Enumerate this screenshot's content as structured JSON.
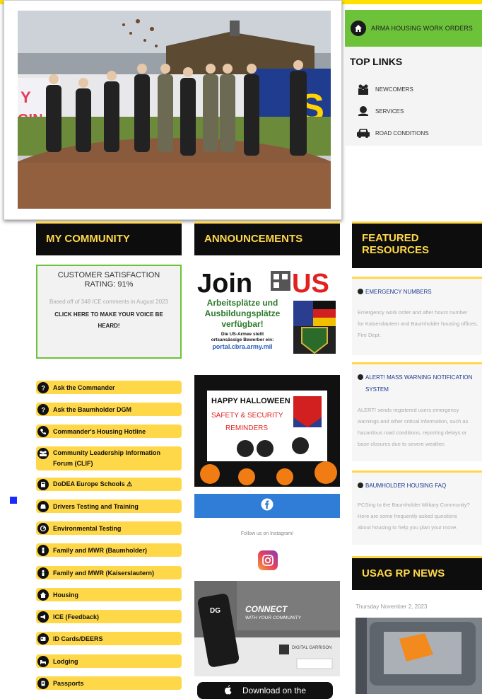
{
  "header": {
    "accent_color": "#ffe000"
  },
  "right_top": {
    "work_orders_label": "ARMA HOUSING WORK ORDERS",
    "top_links_title": "TOP LINKS",
    "top_links": [
      {
        "label": "NEWCOMERS",
        "icon": "people-icon"
      },
      {
        "label": "SERVICES",
        "icon": "globe-hand-icon"
      },
      {
        "label": "ROAD CONDITIONS",
        "icon": "car-icon"
      }
    ]
  },
  "sections": {
    "my_community": "MY COMMUNITY",
    "announcements": "ANNOUNCEMENTS",
    "featured_resources": "FEATURED RESOURCES",
    "news": "USAG RP NEWS"
  },
  "csat": {
    "title": "CUSTOMER SATISFACTION RATING: 91%",
    "subtitle": "Based off of 348 ICE comments in August 2023",
    "cta": "CLICK HERE TO MAKE YOUR VOICE BE HEARD!"
  },
  "community_links": [
    {
      "label": "Ask the Commander",
      "icon": "question-icon"
    },
    {
      "label": "Ask the Baumholder DGM",
      "icon": "question-icon"
    },
    {
      "label": "Commander's Housing Hotline",
      "icon": "phone-icon"
    },
    {
      "label": "Community Leadership Information Forum (CLIF)",
      "icon": "group-icon"
    },
    {
      "label": "DoDEA Europe Schools ⚠",
      "icon": "book-icon"
    },
    {
      "label": "Drivers Testing and Training",
      "icon": "car-icon"
    },
    {
      "label": "Environmental Testing",
      "icon": "gauge-icon"
    },
    {
      "label": "Family and MWR (Baumholder)",
      "icon": "person-icon"
    },
    {
      "label": "Family and MWR (Kaiserslautern)",
      "icon": "person-icon"
    },
    {
      "label": "Housing",
      "icon": "home-icon"
    },
    {
      "label": "ICE (Feedback)",
      "icon": "megaphone-icon"
    },
    {
      "label": "ID Cards/DEERS",
      "icon": "id-card-icon"
    },
    {
      "label": "Lodging",
      "icon": "bed-icon"
    },
    {
      "label": "Passports",
      "icon": "passport-icon"
    }
  ],
  "announcements": {
    "join_us": {
      "join": "Join",
      "us": "US",
      "line1": "Arbeitsplätze und",
      "line2": "Ausbildungsplätze",
      "line3": "verfügbar!",
      "line4": "Die US-Armee stellt",
      "line5": "ortsansässige Bewerber ein:",
      "url": "portal.cbra.army.mil"
    },
    "halloween": {
      "line1": "HAPPY HALLOWEEN",
      "line2": "SAFETY & SECURITY",
      "line3": "REMINDERS"
    },
    "follow_text": "Follow us on Instagram!",
    "digital_garrison": {
      "title": "CONNECT",
      "subtitle": "WITH YOUR COMMUNITY",
      "brand": "DIGITAL GARRISON"
    },
    "download_label": "Download on the"
  },
  "featured": [
    {
      "title": "EMERGENCY NUMBERS",
      "body": [
        "Emergency work order and after hours number",
        "for Kaiserslautern and Baumholder housing offices,",
        "Fire Dept."
      ]
    },
    {
      "title": "ALERT! MASS WARNING NOTIFICATION SYSTEM",
      "body": [
        "ALERT! sends registered users emergency",
        "warnings and other critical information, such as",
        "hazardous road conditions, reporting delays or",
        "base closures due to severe weather."
      ]
    },
    {
      "title": "BAUMHOLDER HOUSING FAQ",
      "body": [
        "PCSing to the Baumholder Military Community?",
        "Here are some frequently asked questions",
        "about housing to help you plan your move."
      ]
    }
  ],
  "news": {
    "date": "Thursday November 2, 2023"
  }
}
